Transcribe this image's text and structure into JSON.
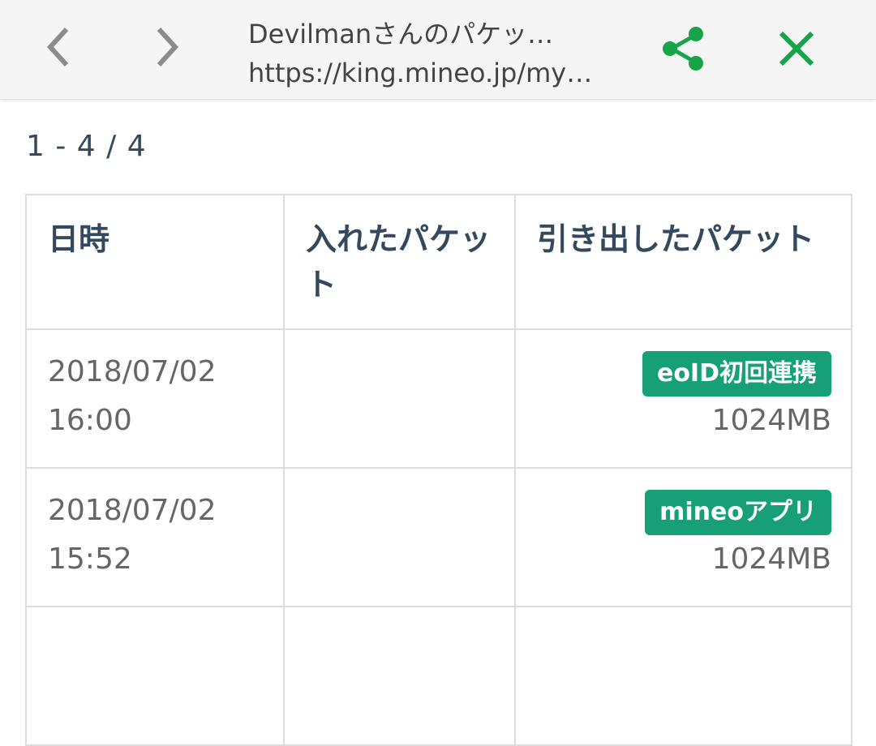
{
  "toolbar": {
    "title": "Devilmanさんのパケッ…",
    "url": "https://king.mineo.jp/my…",
    "back_icon": "chevron-left-icon",
    "forward_icon": "chevron-right-icon",
    "share_icon": "share-icon",
    "close_icon": "close-icon",
    "accent_color": "#17a34a"
  },
  "pagination": {
    "range": "1 - 4 / 4"
  },
  "table": {
    "headers": [
      "日時",
      "入れたパケット",
      "引き出したパケット"
    ],
    "rows": [
      {
        "date": "2018/07/02",
        "time": "16:00",
        "put_in": "",
        "tag": "eoID初回連携",
        "amount": "1024MB"
      },
      {
        "date": "2018/07/02",
        "time": "15:52",
        "put_in": "",
        "tag": "mineoアプリ",
        "amount": "1024MB"
      }
    ],
    "tag_color": "#17a077"
  }
}
